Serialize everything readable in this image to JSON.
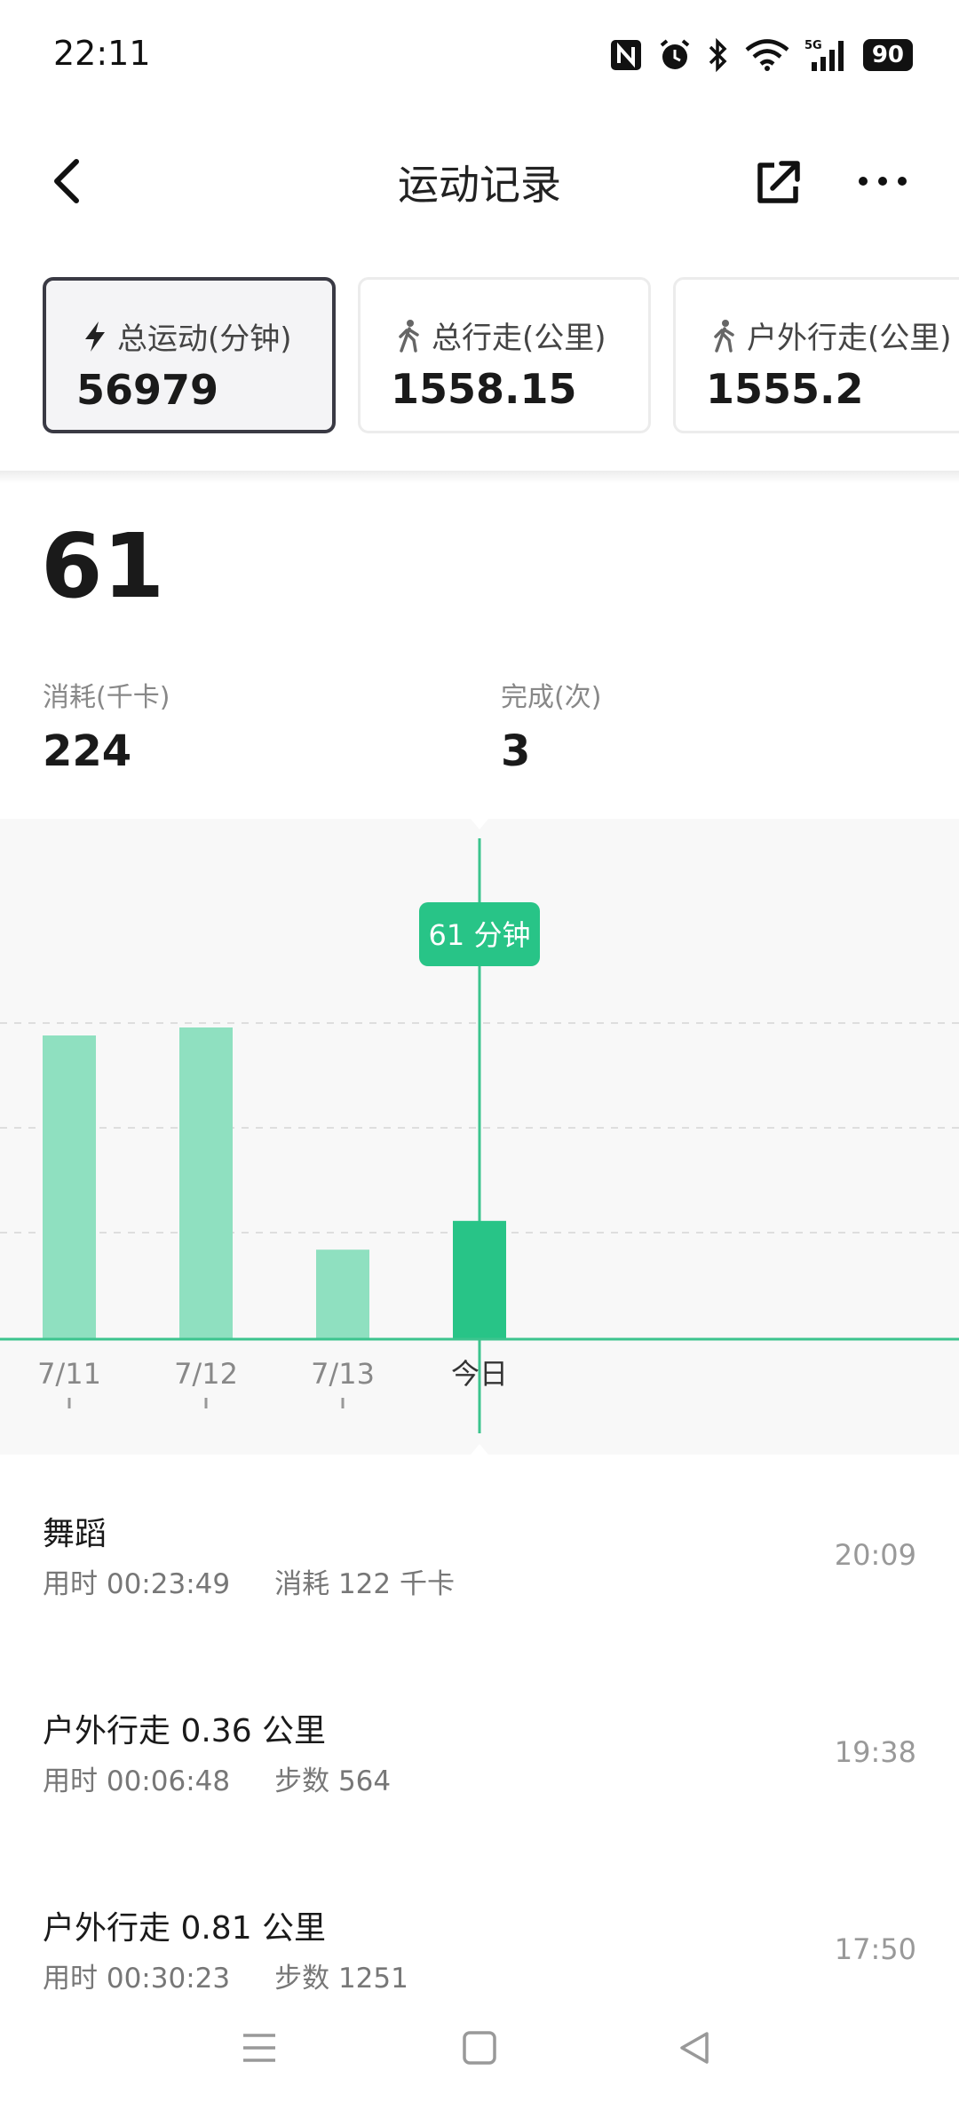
{
  "status": {
    "time": "22:11",
    "battery": "90"
  },
  "header": {
    "title": "运动记录"
  },
  "cards": [
    {
      "label": "总运动(分钟)",
      "value": "56979",
      "icon": "lightning-icon",
      "active": true
    },
    {
      "label": "总行走(公里)",
      "value": "1558.15",
      "icon": "walk-icon",
      "active": false
    },
    {
      "label": "户外行走(公里)",
      "value": "1555.2",
      "icon": "walk-icon",
      "active": false
    }
  ],
  "summary": {
    "duration_value": "61",
    "calories_label": "消耗(千卡)",
    "calories_value": "224",
    "completed_label": "完成(次)",
    "completed_value": "3"
  },
  "chart_data": {
    "type": "bar",
    "categories": [
      "7/11",
      "7/12",
      "7/13",
      "今日"
    ],
    "values": [
      190,
      195,
      56,
      74
    ],
    "highlight_index": 3,
    "tooltip": "61 分钟",
    "colors": {
      "bar": "#8fe0c0",
      "highlight": "#28c487",
      "axis": "#3cc48e"
    }
  },
  "activities": [
    {
      "title": "舞蹈",
      "duration": "用时 00:23:49",
      "extra": "消耗 122 千卡",
      "time": "20:09"
    },
    {
      "title": "户外行走 0.36 公里",
      "duration": "用时 00:06:48",
      "extra": "步数 564",
      "time": "19:38"
    },
    {
      "title": "户外行走 0.81 公里",
      "duration": "用时 00:30:23",
      "extra": "步数 1251",
      "time": "17:50"
    }
  ]
}
